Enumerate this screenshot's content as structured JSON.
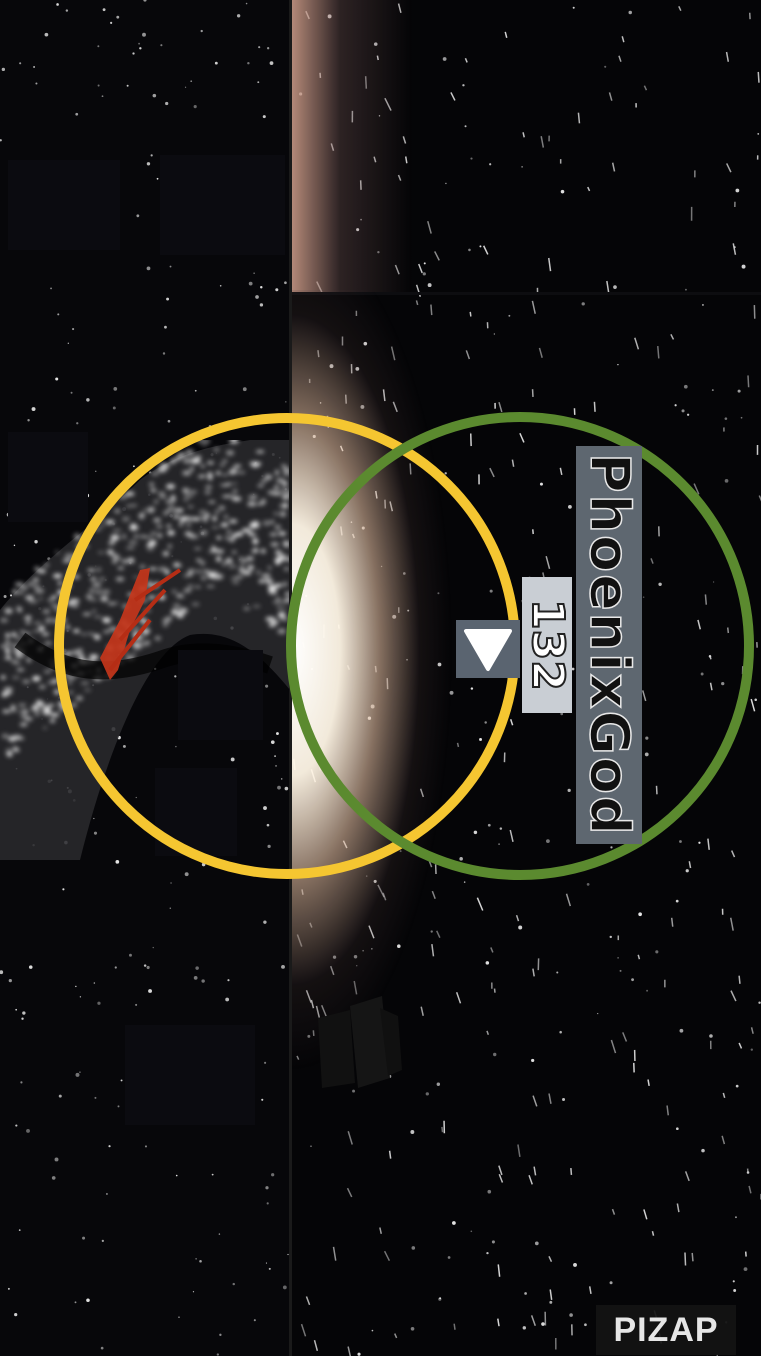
{
  "scene": {
    "colors": {
      "yellow_ring": "#f5c631",
      "green_ring": "#5b8a2f",
      "name_tag_bg": "#5e6770",
      "number_tag_bg": "#c9ced4",
      "triangle_box_bg": "#5a6470",
      "meteor_red": "#c9361b"
    }
  },
  "overlay": {
    "name_label": "PhoenixGod",
    "number_label": "132",
    "triangle_icon": "down-triangle"
  },
  "watermark": {
    "text": "PIZAP"
  }
}
